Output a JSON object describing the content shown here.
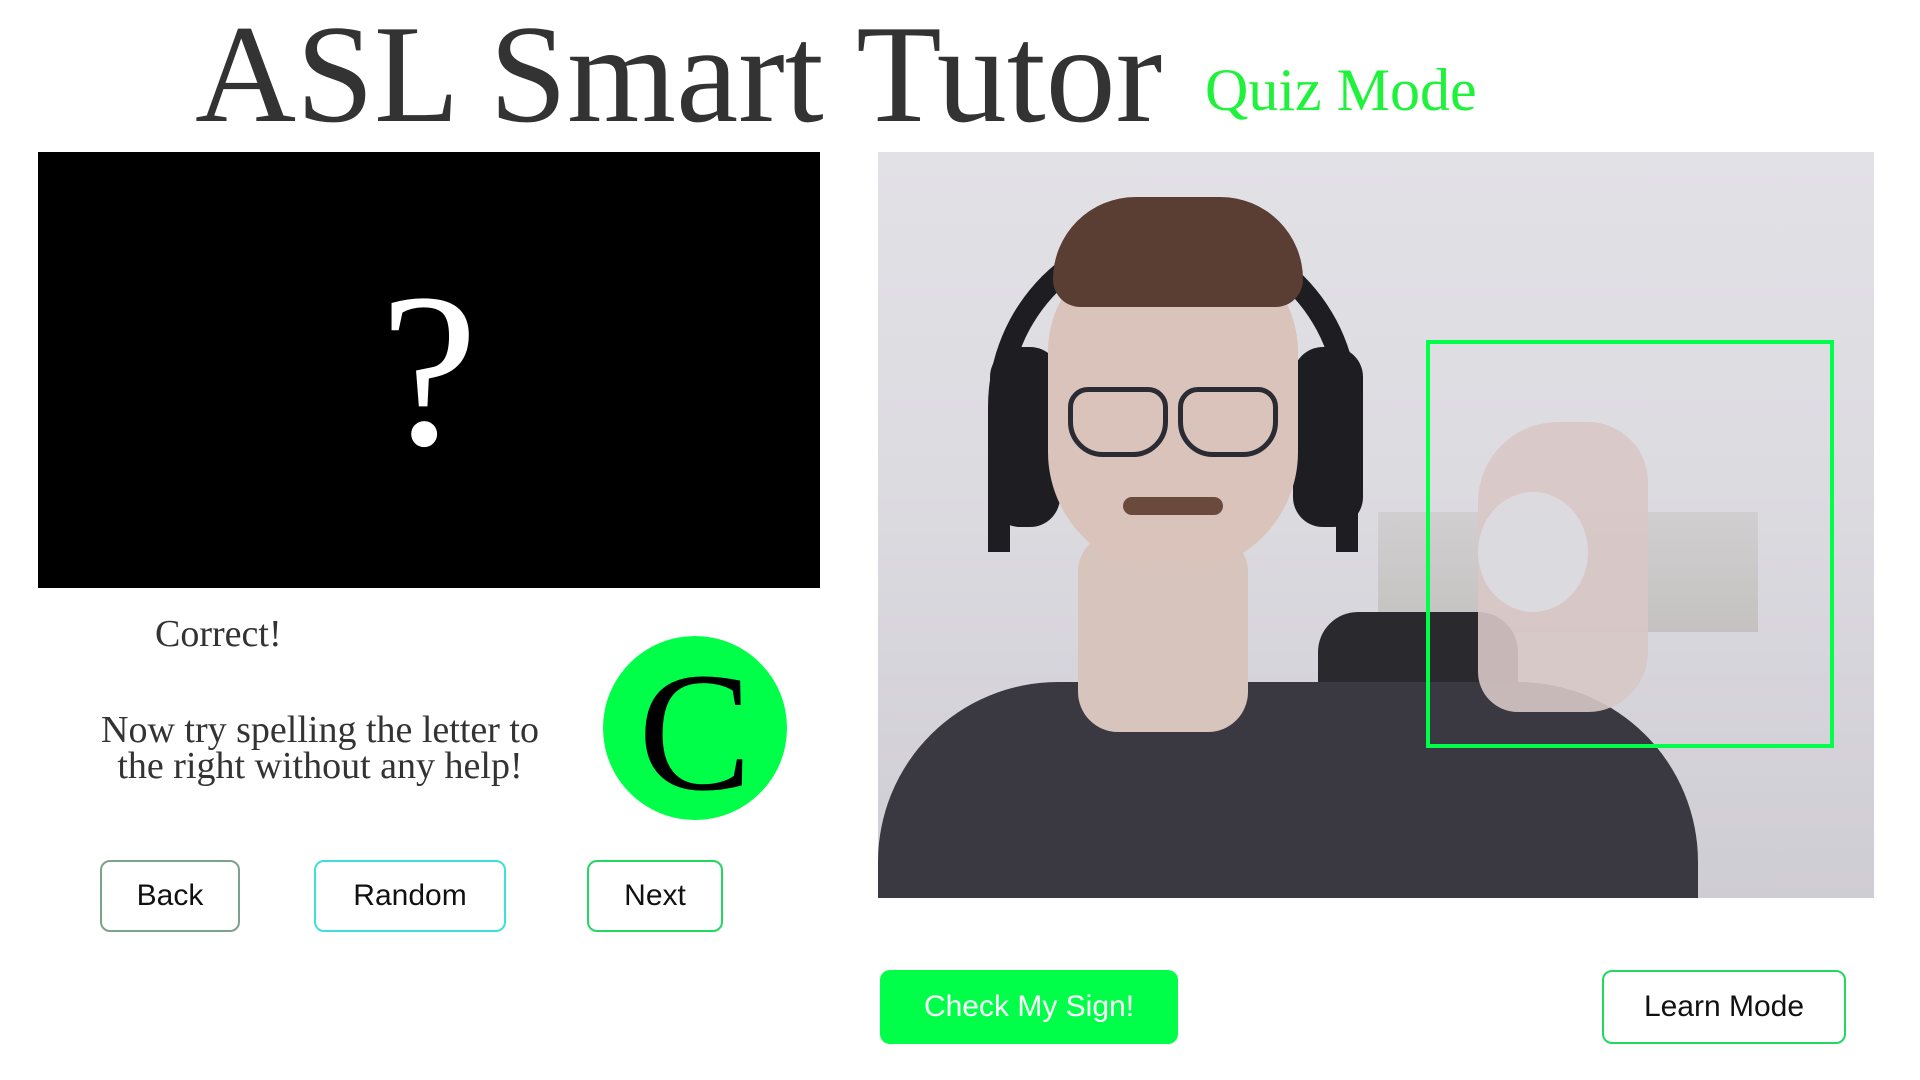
{
  "header": {
    "title": "ASL Smart Tutor",
    "mode": "Quiz Mode"
  },
  "hint_panel": {
    "symbol": "?"
  },
  "feedback": {
    "status": "Correct!",
    "instruction": "Now try spelling the letter to the right without any help!"
  },
  "target_letter": "C",
  "nav": {
    "back_label": "Back",
    "random_label": "Random",
    "next_label": "Next"
  },
  "actions": {
    "check_label": "Check My Sign!",
    "learn_mode_label": "Learn Mode"
  },
  "colors": {
    "accent": "#00ff48",
    "title": "#333333",
    "mode_label": "#1ef23a"
  }
}
